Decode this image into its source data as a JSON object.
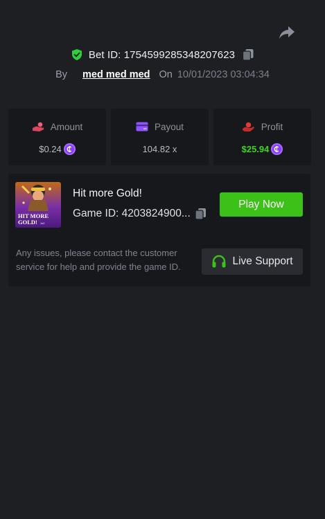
{
  "header": {
    "bet_id_label": "Bet ID: 1754599285348207623",
    "by_label": "By",
    "username": "med med med",
    "on_label": "On",
    "datetime": "10/01/2023 03:04:34"
  },
  "stats": {
    "amount": {
      "label": "Amount",
      "value": "$0.24",
      "icon": "hand-coin-icon"
    },
    "payout": {
      "label": "Payout",
      "value": "104.82 x",
      "icon": "card-icon"
    },
    "profit": {
      "label": "Profit",
      "value": "$25.94",
      "icon": "hand-profit-icon"
    }
  },
  "game": {
    "title": "Hit more Gold!",
    "game_id": "Game ID: 4203824900...",
    "play_label": "Play Now",
    "thumb_text_line1": "HIT MORE",
    "thumb_text_line2": "GOLD!",
    "thumb_brand": "1x2"
  },
  "support": {
    "message": "Any issues, please contact the customer service for help and provide the game ID.",
    "button_label": "Live Support"
  },
  "colors": {
    "background": "#1e1f23",
    "card": "#17181c",
    "accent_green": "#3bc117",
    "coin_purple": "#8a3cff"
  }
}
